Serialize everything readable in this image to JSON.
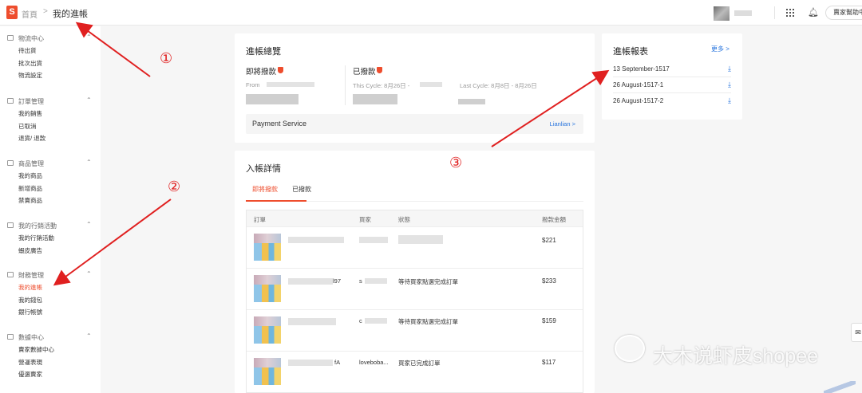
{
  "topbar": {
    "logo": "S",
    "home": "首頁",
    "sep": ">",
    "current": "我的進帳",
    "help_button": "賣家幫助中心"
  },
  "sidebar": [
    {
      "title": "物流中心",
      "items": [
        "待出貨",
        "批次出貨",
        "物流設定"
      ],
      "icon": "truck-icon"
    },
    {
      "title": "訂單管理",
      "items": [
        "我的銷售",
        "已取消",
        "退貨/ 退款"
      ],
      "icon": "order-icon"
    },
    {
      "title": "商品管理",
      "items": [
        "我的商品",
        "新增商品",
        "禁賣商品"
      ],
      "icon": "product-icon"
    },
    {
      "title": "我的行銷活動",
      "items": [
        "我的行銷活動",
        "蝦皮廣告"
      ],
      "icon": "tag-icon"
    },
    {
      "title": "財務管理",
      "items": [
        "我的進帳",
        "我的錢包",
        "銀行帳號"
      ],
      "icon": "wallet-icon"
    },
    {
      "title": "數據中心",
      "items": [
        "賣家數據中心",
        "營運表現",
        "優選賣家"
      ],
      "icon": "chart-icon"
    }
  ],
  "active_item": "我的進帳",
  "overview": {
    "title": "進帳總覽",
    "upcoming_label": "即將撥款",
    "upcoming_from": "From",
    "released_label": "已撥款",
    "this_cycle": "This Cycle: 8月26日 -",
    "last_cycle": "Last Cycle: 8月8日 - 8月26日",
    "payment_service": "Payment Service",
    "payment_provider": "Lianlian >"
  },
  "reports": {
    "title": "進帳報表",
    "more": "更多 >",
    "items": [
      "13 September-1517",
      "26 August-1517-1",
      "26 August-1517-2"
    ]
  },
  "details": {
    "title": "入帳詳情",
    "tabs": [
      "即將撥款",
      "已撥款"
    ],
    "columns": [
      "訂單",
      "買家",
      "狀態",
      "撥款金額"
    ],
    "rows": [
      {
        "order_suffix": "",
        "buyer": "",
        "status": "",
        "amount": "$221"
      },
      {
        "order_suffix": "l97",
        "buyer": "s",
        "status": "等待買家點選完成訂單",
        "amount": "$233"
      },
      {
        "order_suffix": "",
        "buyer": "c",
        "status": "等待買家點選完成訂單",
        "amount": "$159"
      },
      {
        "order_suffix": "fA",
        "buyer": "loveboba...",
        "status": "買家已完成訂單",
        "amount": "$117"
      }
    ]
  },
  "annotations": [
    "①",
    "②",
    "③"
  ],
  "watermark": "大木说虾皮shopee",
  "colors": {
    "brand": "#ee4d2d",
    "link": "#2673dd",
    "annotation": "#e02020"
  }
}
